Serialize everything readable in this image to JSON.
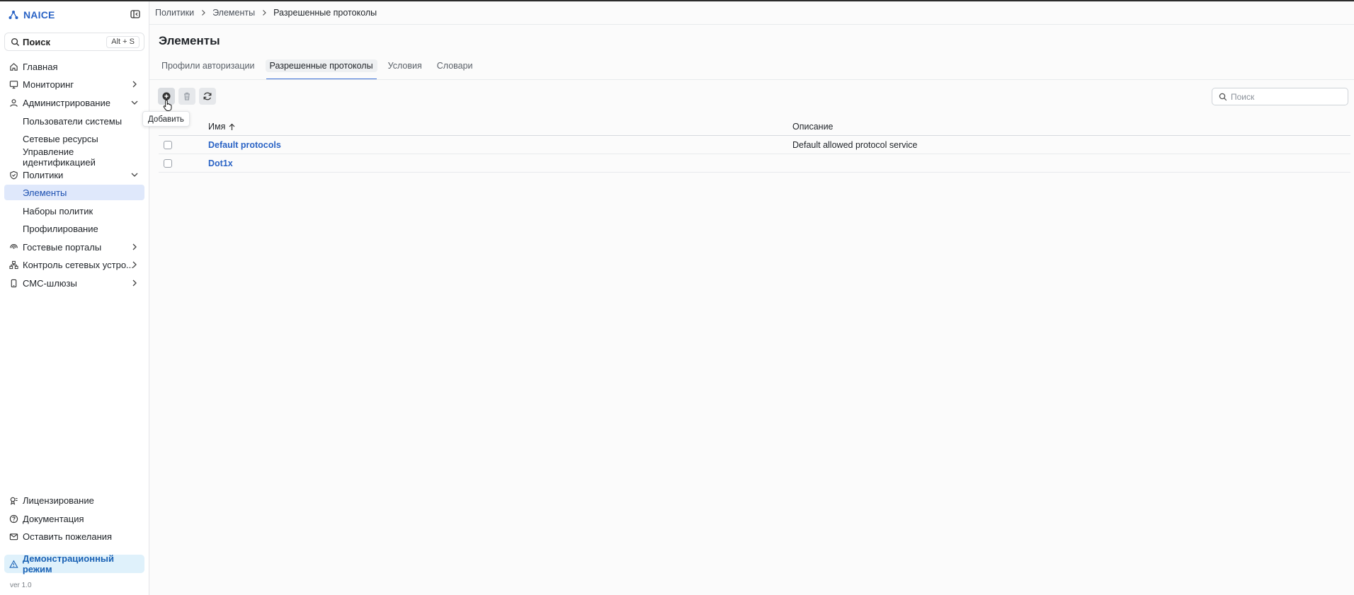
{
  "app": {
    "name": "NAICE",
    "version": "ver 1.0"
  },
  "sidebar": {
    "search_label": "Поиск",
    "search_shortcut": "Alt + S",
    "items": [
      {
        "label": "Главная",
        "icon": "home-icon"
      },
      {
        "label": "Мониторинг",
        "icon": "monitor-icon"
      },
      {
        "label": "Администрирование",
        "icon": "user-icon"
      },
      {
        "label": "Пользователи системы"
      },
      {
        "label": "Сетевые ресурсы"
      },
      {
        "label": "Управление идентификацией"
      },
      {
        "label": "Политики",
        "icon": "shield-check-icon"
      },
      {
        "label": "Элементы",
        "active": true
      },
      {
        "label": "Наборы политик"
      },
      {
        "label": "Профилирование"
      },
      {
        "label": "Гостевые порталы",
        "icon": "wifi-icon"
      },
      {
        "label": "Контроль сетевых устро...",
        "icon": "network-icon"
      },
      {
        "label": "СМС-шлюзы",
        "icon": "phone-icon"
      }
    ],
    "footer": [
      {
        "label": "Лицензирование",
        "icon": "license-icon"
      },
      {
        "label": "Документация",
        "icon": "help-circle-icon"
      },
      {
        "label": "Оставить пожелания",
        "icon": "mail-icon"
      }
    ],
    "demo_label": "Демонстрационный режим"
  },
  "breadcrumb": [
    "Политики",
    "Элементы",
    "Разрешенные протоколы"
  ],
  "page": {
    "title": "Элементы",
    "tabs": [
      {
        "label": "Профили авторизации"
      },
      {
        "label": "Разрешенные протоколы",
        "active": true
      },
      {
        "label": "Условия"
      },
      {
        "label": "Словари"
      }
    ]
  },
  "toolbar": {
    "add_tooltip": "Добавить",
    "search_placeholder": "Поиск"
  },
  "table": {
    "columns": {
      "name": "Имя",
      "description": "Описание"
    },
    "rows": [
      {
        "name": "Default protocols",
        "description": "Default allowed protocol service"
      },
      {
        "name": "Dot1x",
        "description": ""
      }
    ]
  },
  "colors": {
    "brand": "#2a63c5",
    "active_nav_bg": "#dfe8fb",
    "demo_bg": "#dff1fb",
    "tab_underline": "#3a6fd6"
  }
}
